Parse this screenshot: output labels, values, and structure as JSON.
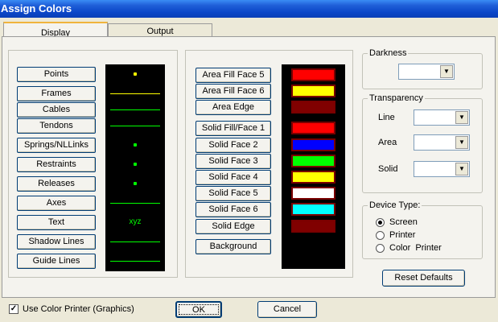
{
  "window": {
    "title": "Assign Colors"
  },
  "tabs": [
    {
      "label": "Display",
      "active": true
    },
    {
      "label": "Output",
      "active": false
    }
  ],
  "display_items": [
    {
      "label": "Points",
      "preview": "point",
      "color": "#ffff00"
    },
    {
      "label": "Frames",
      "preview": "line",
      "color": "#ffff00"
    },
    {
      "label": "Cables",
      "preview": "line",
      "color": "#00ff00"
    },
    {
      "label": "Tendons",
      "preview": "line",
      "color": "#00ff00"
    },
    {
      "label": "Springs/NLLinks",
      "preview": "point",
      "color": "#00ff00"
    },
    {
      "label": "Restraints",
      "preview": "point",
      "color": "#00ff00"
    },
    {
      "label": "Releases",
      "preview": "point",
      "color": "#00ff00"
    },
    {
      "label": "Axes",
      "preview": "line",
      "color": "#00ff00"
    },
    {
      "label": "Text",
      "preview": "text",
      "color": "#00ff00"
    },
    {
      "label": "Shadow Lines",
      "preview": "line",
      "color": "#00ff00"
    },
    {
      "label": "Guide Lines",
      "preview": "line",
      "color": "#00ff00"
    }
  ],
  "preview_text": "xyz",
  "face_group_a": [
    {
      "label": "Area Fill Face 5",
      "color": "#ff0000"
    },
    {
      "label": "Area Fill Face 6",
      "color": "#ffff00"
    },
    {
      "label": "Area Edge",
      "color": "#800000"
    }
  ],
  "face_group_b": [
    {
      "label": "Solid Fill/Face 1",
      "color": "#ff0000"
    },
    {
      "label": "Solid Face 2",
      "color": "#0000ff"
    },
    {
      "label": "Solid Face 3",
      "color": "#00ff00"
    },
    {
      "label": "Solid Face 4",
      "color": "#ffff00"
    },
    {
      "label": "Solid Face 5",
      "color": "#ffffff"
    },
    {
      "label": "Solid Face 6",
      "color": "#00ffff"
    },
    {
      "label": "Solid Edge",
      "color": "#800000"
    }
  ],
  "background": {
    "label": "Background"
  },
  "darkness": {
    "legend": "Darkness",
    "value": ""
  },
  "transparency": {
    "legend": "Transparency",
    "line_label": "Line",
    "line_value": "",
    "area_label": "Area",
    "area_value": "",
    "solid_label": "Solid",
    "solid_value": ""
  },
  "device_type": {
    "legend": "Device Type:",
    "options": [
      "Screen",
      "Printer",
      "Color  Printer"
    ],
    "selected": "Screen"
  },
  "reset_defaults": "Reset Defaults",
  "use_color_printer": {
    "label": "Use Color Printer (Graphics)",
    "checked": true,
    "mark": "✓"
  },
  "ok_label": "OK",
  "cancel_label": "Cancel",
  "icons": {
    "dropdown": "▼"
  }
}
